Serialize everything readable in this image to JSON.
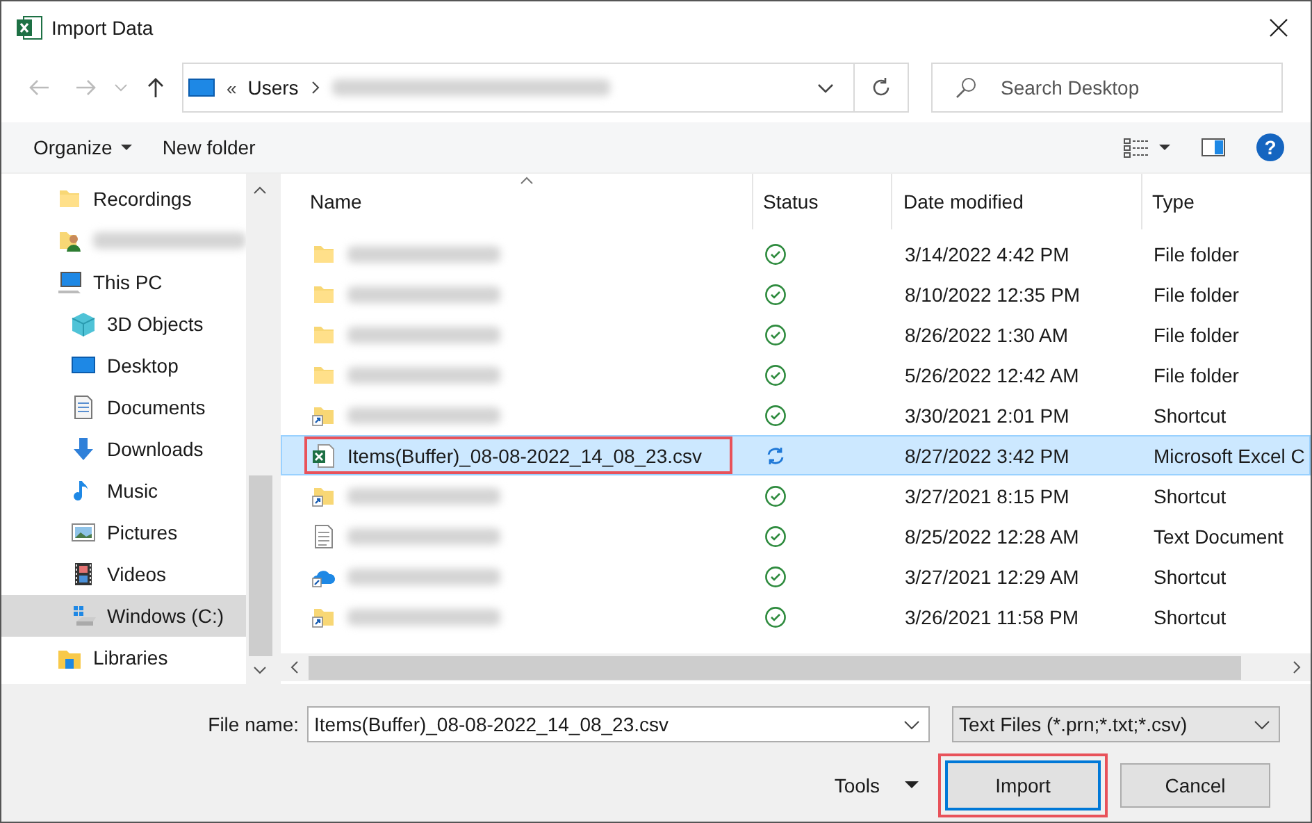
{
  "window": {
    "title": "Import Data"
  },
  "address": {
    "overflow": "«",
    "segments": [
      "Users"
    ],
    "hidden_path": true
  },
  "search": {
    "placeholder": "Search Desktop"
  },
  "toolbar": {
    "organize": "Organize",
    "new_folder": "New folder",
    "help": "?"
  },
  "sidebar": {
    "items": [
      {
        "label": "Recordings",
        "kind": "folder",
        "selected": false
      },
      {
        "kind": "user",
        "selected": false,
        "blurred": true
      },
      {
        "label": "This PC",
        "kind": "pc",
        "selected": false,
        "children": [
          {
            "label": "3D Objects",
            "kind": "cube",
            "selected": false
          },
          {
            "label": "Desktop",
            "kind": "desktop",
            "selected": false
          },
          {
            "label": "Documents",
            "kind": "document",
            "selected": false
          },
          {
            "label": "Downloads",
            "kind": "download",
            "selected": false
          },
          {
            "label": "Music",
            "kind": "music",
            "selected": false
          },
          {
            "label": "Pictures",
            "kind": "picture",
            "selected": false
          },
          {
            "label": "Videos",
            "kind": "video",
            "selected": false
          },
          {
            "label": "Windows (C:)",
            "kind": "drive",
            "selected": true
          }
        ]
      },
      {
        "label": "Libraries",
        "kind": "library",
        "selected": false
      }
    ]
  },
  "table": {
    "columns": [
      "Name",
      "Status",
      "Date modified",
      "Type"
    ],
    "rows": [
      {
        "kind": "folder",
        "syncing": false,
        "date": "3/14/2022 4:42 PM",
        "type": "File folder",
        "selected": false,
        "highlighted": false
      },
      {
        "kind": "folder",
        "syncing": false,
        "date": "8/10/2022 12:35 PM",
        "type": "File folder",
        "selected": false,
        "highlighted": false
      },
      {
        "kind": "folder",
        "syncing": false,
        "date": "8/26/2022 1:30 AM",
        "type": "File folder",
        "selected": false,
        "highlighted": false
      },
      {
        "kind": "folder",
        "syncing": false,
        "date": "5/26/2022 12:42 AM",
        "type": "File folder",
        "selected": false,
        "highlighted": false
      },
      {
        "kind": "shortcut",
        "syncing": false,
        "date": "3/30/2021 2:01 PM",
        "type": "Shortcut",
        "selected": false,
        "highlighted": false
      },
      {
        "kind": "excel",
        "name": "Items(Buffer)_08-08-2022_14_08_23.csv",
        "syncing": true,
        "date": "8/27/2022 3:42 PM",
        "type": "Microsoft Excel C",
        "selected": true,
        "highlighted": true
      },
      {
        "kind": "shortcut",
        "syncing": false,
        "date": "3/27/2021 8:15 PM",
        "type": "Shortcut",
        "selected": false,
        "highlighted": false
      },
      {
        "kind": "text",
        "syncing": false,
        "date": "8/25/2022 12:28 AM",
        "type": "Text Document",
        "selected": false,
        "highlighted": false
      },
      {
        "kind": "cloud",
        "syncing": false,
        "date": "3/27/2021 12:29 AM",
        "type": "Shortcut",
        "selected": false,
        "highlighted": false
      },
      {
        "kind": "shortcut",
        "syncing": false,
        "date": "3/26/2021 11:58 PM",
        "type": "Shortcut",
        "selected": false,
        "highlighted": false
      }
    ]
  },
  "footer": {
    "file_name_label": "File name:",
    "file_name": "Items(Buffer)_08-08-2022_14_08_23.csv",
    "file_type": "Text Files (*.prn;*.txt;*.csv)",
    "tools": "Tools",
    "buttons": [
      {
        "label": "Import",
        "kind": "primary",
        "highlighted": true
      },
      {
        "label": "Cancel",
        "kind": "normal",
        "highlighted": false
      }
    ]
  }
}
